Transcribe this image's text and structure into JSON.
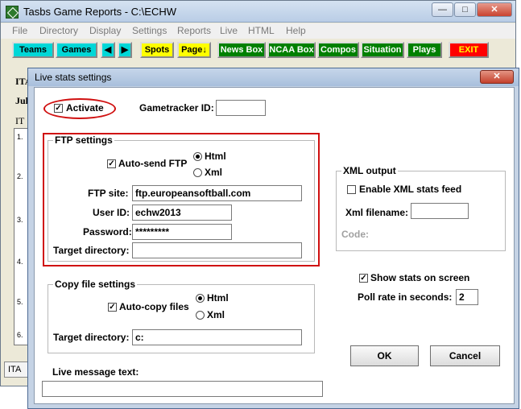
{
  "window": {
    "title": "Tasbs Game Reports - C:\\ECHW"
  },
  "menu": [
    "File",
    "Directory",
    "Display",
    "Settings",
    "Reports",
    "Live",
    "HTML",
    "Help"
  ],
  "toolbar": {
    "teams": "Teams",
    "games": "Games",
    "spots": "Spots",
    "page": "Page↓",
    "news_box": "News Box",
    "ncaa_box": "NCAA Box",
    "compos": "Compos",
    "situation": "Situation",
    "plays": "Plays",
    "exit": "EXIT"
  },
  "background": {
    "line1": "ITA",
    "line2": "Jul",
    "line3": "IT",
    "rows": [
      "1.",
      "2.",
      "3.",
      "4.",
      "5.",
      "6."
    ],
    "status": "ITA"
  },
  "dialog": {
    "title": "Live stats settings",
    "activate": {
      "label": "Activate",
      "checked": true
    },
    "gametracker_label": "Gametracker ID:",
    "gametracker_value": "",
    "ftp": {
      "title": "FTP settings",
      "auto_send_label": "Auto-send FTP",
      "auto_send_checked": true,
      "format_html": "Html",
      "format_xml": "Xml",
      "format_selected": "Html",
      "site_label": "FTP site:",
      "site_value": "ftp.europeansoftball.com",
      "user_label": "User ID:",
      "user_value": "echw2013",
      "password_label": "Password:",
      "password_value": "*********",
      "target_label": "Target directory:",
      "target_value": ""
    },
    "xml": {
      "title": "XML output",
      "enable_label": "Enable XML stats feed",
      "enable_checked": false,
      "filename_label": "Xml filename:",
      "filename_value": "",
      "code_label": "Code:"
    },
    "copy": {
      "title": "Copy file settings",
      "auto_copy_label": "Auto-copy files",
      "auto_copy_checked": true,
      "format_html": "Html",
      "format_xml": "Xml",
      "format_selected": "Html",
      "target_label": "Target directory:",
      "target_value": "c:"
    },
    "show_stats_label": "Show stats on screen",
    "show_stats_checked": true,
    "poll_label": "Poll rate in seconds:",
    "poll_value": "2",
    "live_message_label": "Live message text:",
    "live_message_value": "",
    "ok": "OK",
    "cancel": "Cancel"
  },
  "colors": {
    "highlight": "#d01010",
    "toolbar_cyan": "#00d7d7",
    "toolbar_green": "#008000"
  }
}
